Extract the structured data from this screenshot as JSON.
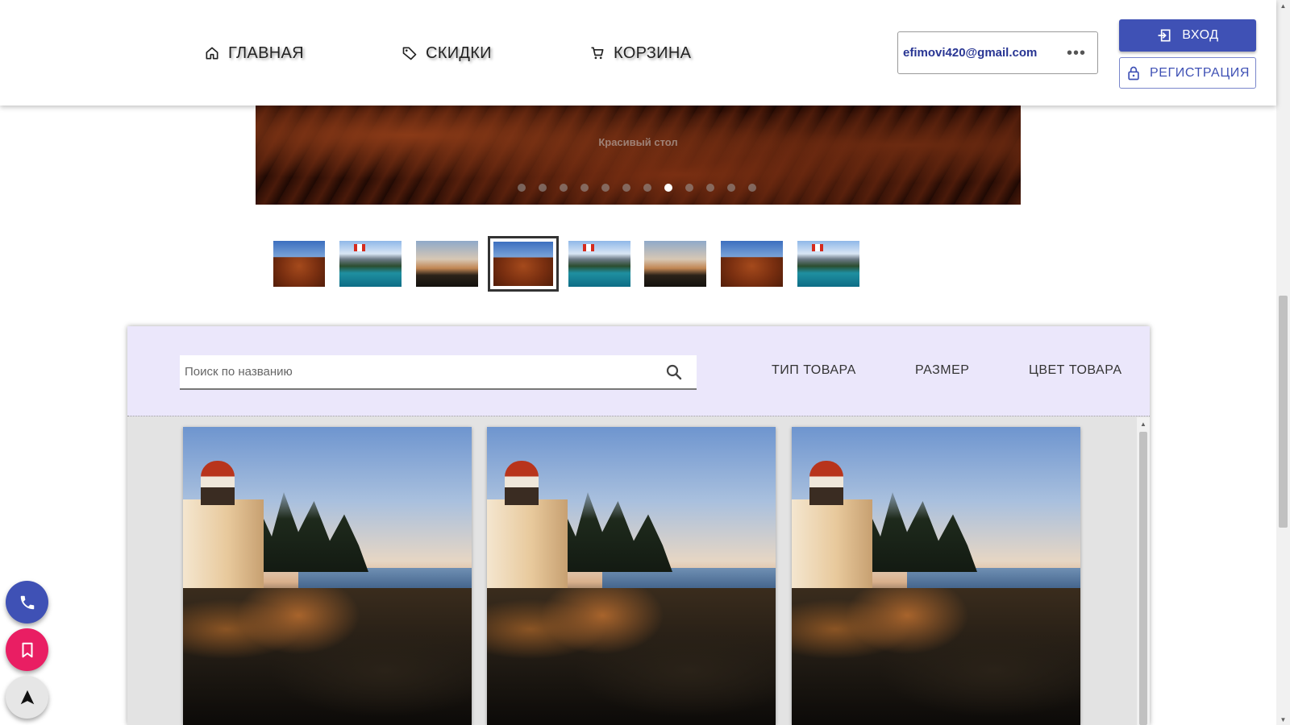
{
  "nav": {
    "home": "ГЛАВНАЯ",
    "sales": "СКИДКИ",
    "cart": "КОРЗИНА"
  },
  "user": {
    "email": "efimovi420@gmail.com",
    "more": "•••"
  },
  "auth": {
    "login": "ВХОД",
    "register": "РЕГИСТРАЦИЯ"
  },
  "hero": {
    "caption": "Красивый стол",
    "dots_total": 12,
    "active_dot": 8
  },
  "thumbnails": [
    "desert",
    "lake-canada",
    "lighthouse",
    "desert",
    "lake-canada",
    "lighthouse",
    "desert",
    "lake-canada"
  ],
  "thumbnail_selected": 4,
  "filters": {
    "search_placeholder": "Поиск по названию",
    "type": "ТИП ТОВАРА",
    "size": "РАЗМЕР",
    "color": "ЦВЕТ ТОВАРА"
  },
  "products": [
    "lighthouse",
    "lighthouse",
    "lighthouse"
  ],
  "fabs": [
    "phone-icon",
    "bookmark-icon",
    "arrow-up-icon"
  ],
  "colors": {
    "primary": "#3f51b5",
    "accent": "#e91e63",
    "filter_bg": "#ebe7fb"
  }
}
